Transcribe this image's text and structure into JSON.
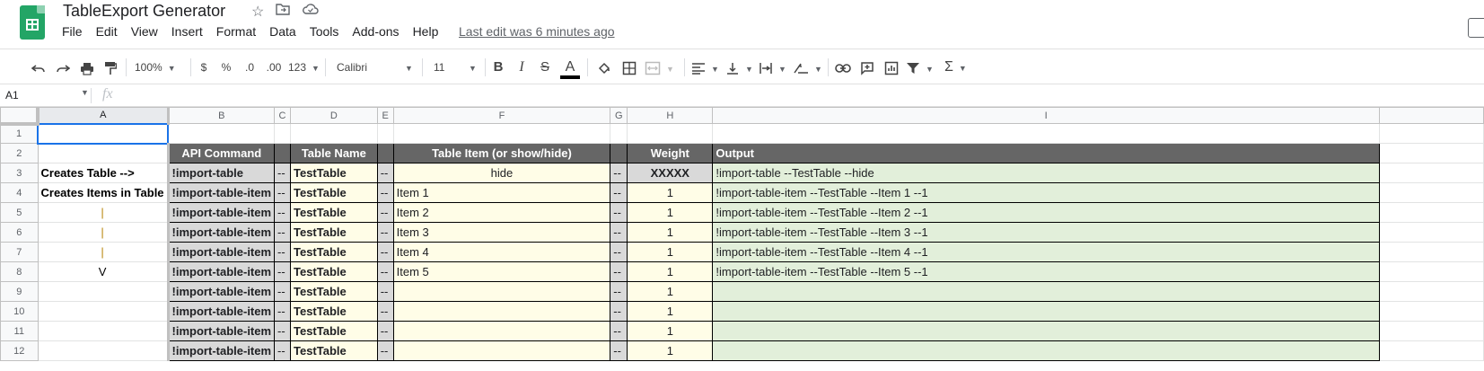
{
  "app": {
    "doc_title": "TableExport Generator",
    "last_edit": "Last edit was 6 minutes ago",
    "menu": [
      "File",
      "Edit",
      "View",
      "Insert",
      "Format",
      "Data",
      "Tools",
      "Add-ons",
      "Help"
    ]
  },
  "toolbar": {
    "zoom": "100%",
    "currency": "$",
    "percent": "%",
    "decrease_decimals": ".0",
    "increase_decimals": ".00",
    "number_format": "123",
    "font": "Calibri",
    "font_size": "11",
    "bold": "B",
    "italic": "I",
    "strikethrough": "S",
    "text_color": "A",
    "sum": "Σ",
    "icons": [
      "undo-icon",
      "redo-icon",
      "print-icon",
      "paint-format-icon",
      "fill-color-icon",
      "borders-icon",
      "merge-cells-icon",
      "align-left-icon",
      "vertical-align-icon",
      "text-wrap-icon",
      "text-rotation-icon",
      "link-icon",
      "comment-icon",
      "chart-icon",
      "filter-icon",
      "functions-icon"
    ]
  },
  "formula_bar": {
    "cell_ref": "A1",
    "fx": "fx",
    "value": ""
  },
  "grid": {
    "columns": [
      "A",
      "B",
      "C",
      "D",
      "E",
      "F",
      "G",
      "H",
      "I"
    ],
    "selected_cell": "A1",
    "header_row": {
      "b": "API Command",
      "d": "Table Name",
      "f": "Table Item (or show/hide)",
      "h": "Weight",
      "i": "Output"
    },
    "rows": [
      {
        "num": "1",
        "a": "",
        "b": "",
        "c": "",
        "d": "",
        "e": "",
        "f": "",
        "g": "",
        "h": "",
        "i": ""
      },
      {
        "num": "2",
        "a": "",
        "b": "API Command",
        "c": "",
        "d": "Table Name",
        "e": "",
        "f": "Table Item (or show/hide)",
        "g": "",
        "h": "Weight",
        "i": "Output"
      },
      {
        "num": "3",
        "a": "Creates Table -->",
        "b": "!import-table",
        "c": "--",
        "d": "TestTable",
        "e": "--",
        "f": "hide",
        "g": "--",
        "h": "XXXXX",
        "i": "!import-table --TestTable --hide"
      },
      {
        "num": "4",
        "a": "Creates Items in Table",
        "b": "!import-table-item",
        "c": "--",
        "d": "TestTable",
        "e": "--",
        "f": "Item 1",
        "g": "--",
        "h": "1",
        "i": "!import-table-item --TestTable --Item 1 --1"
      },
      {
        "num": "5",
        "a": "|",
        "b": "!import-table-item",
        "c": "--",
        "d": "TestTable",
        "e": "--",
        "f": "Item 2",
        "g": "--",
        "h": "1",
        "i": "!import-table-item --TestTable --Item 2 --1"
      },
      {
        "num": "6",
        "a": "|",
        "b": "!import-table-item",
        "c": "--",
        "d": "TestTable",
        "e": "--",
        "f": "Item 3",
        "g": "--",
        "h": "1",
        "i": "!import-table-item --TestTable --Item 3 --1"
      },
      {
        "num": "7",
        "a": "|",
        "b": "!import-table-item",
        "c": "--",
        "d": "TestTable",
        "e": "--",
        "f": "Item 4",
        "g": "--",
        "h": "1",
        "i": "!import-table-item --TestTable --Item 4 --1"
      },
      {
        "num": "8",
        "a": "V",
        "b": "!import-table-item",
        "c": "--",
        "d": "TestTable",
        "e": "--",
        "f": "Item 5",
        "g": "--",
        "h": "1",
        "i": "!import-table-item --TestTable --Item 5 --1"
      },
      {
        "num": "9",
        "a": "",
        "b": "!import-table-item",
        "c": "--",
        "d": "TestTable",
        "e": "--",
        "f": "",
        "g": "--",
        "h": "1",
        "i": ""
      },
      {
        "num": "10",
        "a": "",
        "b": "!import-table-item",
        "c": "--",
        "d": "TestTable",
        "e": "--",
        "f": "",
        "g": "--",
        "h": "1",
        "i": ""
      },
      {
        "num": "11",
        "a": "",
        "b": "!import-table-item",
        "c": "--",
        "d": "TestTable",
        "e": "--",
        "f": "",
        "g": "--",
        "h": "1",
        "i": ""
      },
      {
        "num": "12",
        "a": "",
        "b": "!import-table-item",
        "c": "--",
        "d": "TestTable",
        "e": "--",
        "f": "",
        "g": "--",
        "h": "1",
        "i": ""
      }
    ]
  }
}
